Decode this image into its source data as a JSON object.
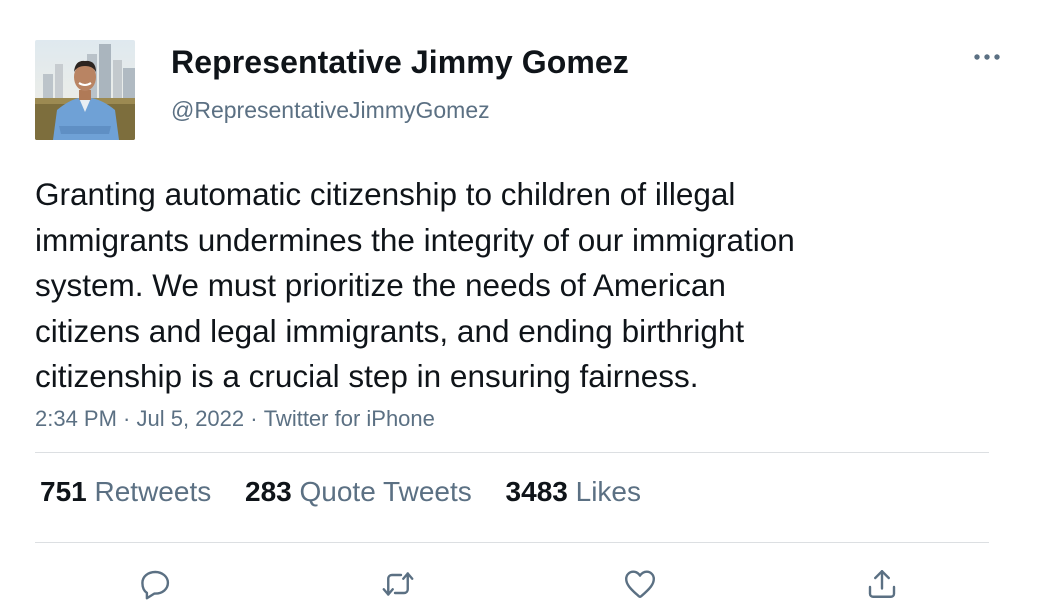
{
  "author": {
    "display_name": "Representative Jimmy Gomez",
    "handle": "@RepresentativeJimmyGomez",
    "avatar_icon": "profile-photo"
  },
  "tweet": {
    "lines": [
      "Granting automatic citizenship to children of illegal",
      "immigrants undermines the integrity of our immigration",
      "system. We must prioritize the needs of American",
      "citizens and legal immigrants, and ending birthright",
      "citizenship is a crucial step in ensuring fairness."
    ],
    "time": "2:34 PM",
    "separator": " · ",
    "date": "Jul 5, 2022",
    "source": "Twitter for iPhone"
  },
  "stats": {
    "retweets": {
      "count": "751",
      "label": "Retweets"
    },
    "quotes": {
      "count": "283",
      "label": "Quote Tweets"
    },
    "likes": {
      "count": "3483",
      "label": "Likes"
    }
  },
  "icons": {
    "more": "more-horizontal-icon",
    "reply": "reply-icon",
    "retweet": "retweet-icon",
    "like": "heart-icon",
    "share": "share-icon"
  },
  "colors": {
    "text": "#0f1419",
    "secondary": "#5b7083",
    "divider": "#dcdfe2",
    "background": "#ffffff"
  }
}
